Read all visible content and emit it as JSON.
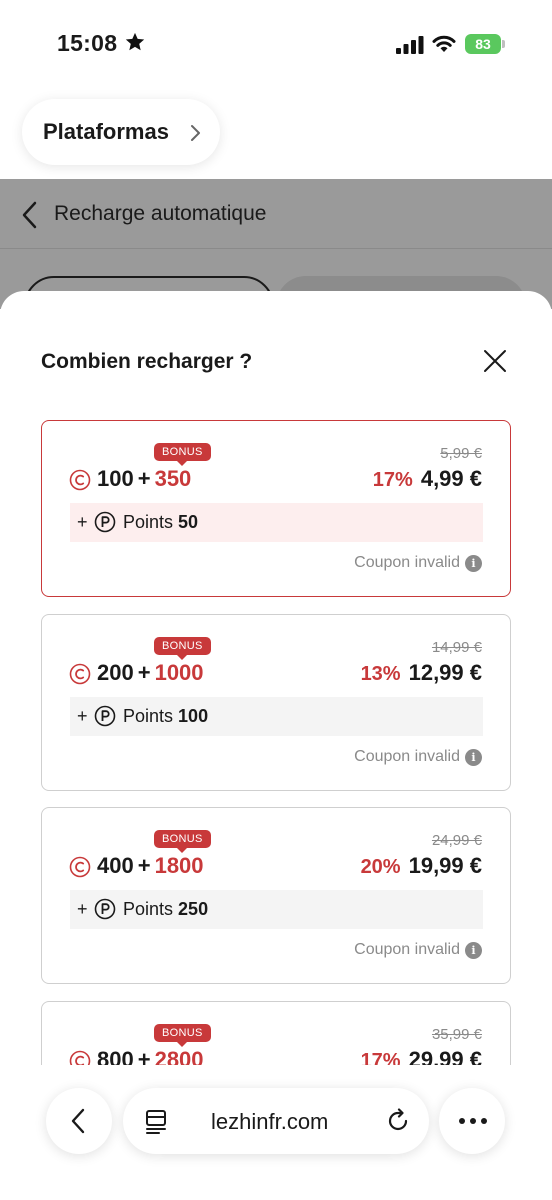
{
  "status_bar": {
    "time": "15:08",
    "battery": "83"
  },
  "app_switcher": {
    "label": "Plataformas"
  },
  "page": {
    "title": "Recharge automatique"
  },
  "sheet": {
    "title": "Combien recharger ?",
    "packages": [
      {
        "bonus_tag": "BONUS",
        "coins": "100",
        "plus": "+",
        "bonus_coins": "350",
        "old_price": "5,99 €",
        "discount": "17%",
        "price": "4,99 €",
        "points_plus": "+",
        "points_label": "Points",
        "points_value": "50",
        "coupon": "Coupon invalid",
        "selected": true
      },
      {
        "bonus_tag": "BONUS",
        "coins": "200",
        "plus": "+",
        "bonus_coins": "1000",
        "old_price": "14,99 €",
        "discount": "13%",
        "price": "12,99 €",
        "points_plus": "+",
        "points_label": "Points",
        "points_value": "100",
        "coupon": "Coupon invalid",
        "selected": false
      },
      {
        "bonus_tag": "BONUS",
        "coins": "400",
        "plus": "+",
        "bonus_coins": "1800",
        "old_price": "24,99 €",
        "discount": "20%",
        "price": "19,99 €",
        "points_plus": "+",
        "points_label": "Points",
        "points_value": "250",
        "coupon": "Coupon invalid",
        "selected": false
      },
      {
        "bonus_tag": "BONUS",
        "coins": "800",
        "plus": "+",
        "bonus_coins": "2800",
        "old_price": "35,99 €",
        "discount": "17%",
        "price": "29,99 €",
        "points_plus": "+",
        "points_label": "Points",
        "points_value": "",
        "coupon": "",
        "selected": false
      }
    ]
  },
  "browser": {
    "url": "lezhinfr.com"
  },
  "colors": {
    "accent": "#c8393a",
    "battery": "#5ac85e",
    "muted": "#8a8a8a"
  }
}
